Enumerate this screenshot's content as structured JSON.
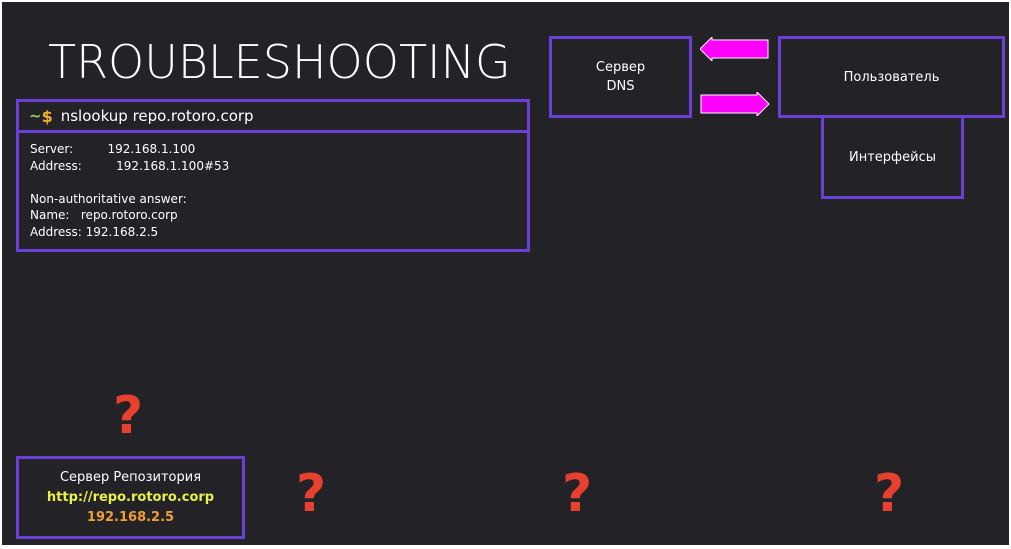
{
  "title": "TROUBLESHOOTING",
  "terminal": {
    "prompt_tilde": "~",
    "prompt_dollar": "$",
    "command": "nslookup  repo.rotoro.corp",
    "output": [
      "Server:         192.168.1.100",
      "Address:         192.168.1.100#53",
      "",
      "Non-authoritative answer:",
      "Name:   repo.rotoro.corp",
      "Address: 192.168.2.5"
    ]
  },
  "dns_server": {
    "line1": "Сервер",
    "line2": "DNS"
  },
  "user_box": {
    "label": "Пользователь"
  },
  "interfaces_box": {
    "label": "Интерфейсы"
  },
  "repo_server": {
    "name": "Сервер Репозитория",
    "url": "http://repo.rotoro.corp",
    "ip": "192.168.2.5"
  },
  "question_mark": "?",
  "colors": {
    "background": "#232227",
    "border": "#6a3fd6",
    "arrow": "#ff00ff",
    "question": "#e8402f",
    "url": "#e8f04a",
    "ip": "#f0a030",
    "prompt_tilde": "#8fd14f",
    "prompt_dollar": "#f0b429"
  },
  "icons": {
    "arrow_left": "arrow-left-icon",
    "arrow_right": "arrow-right-icon"
  }
}
